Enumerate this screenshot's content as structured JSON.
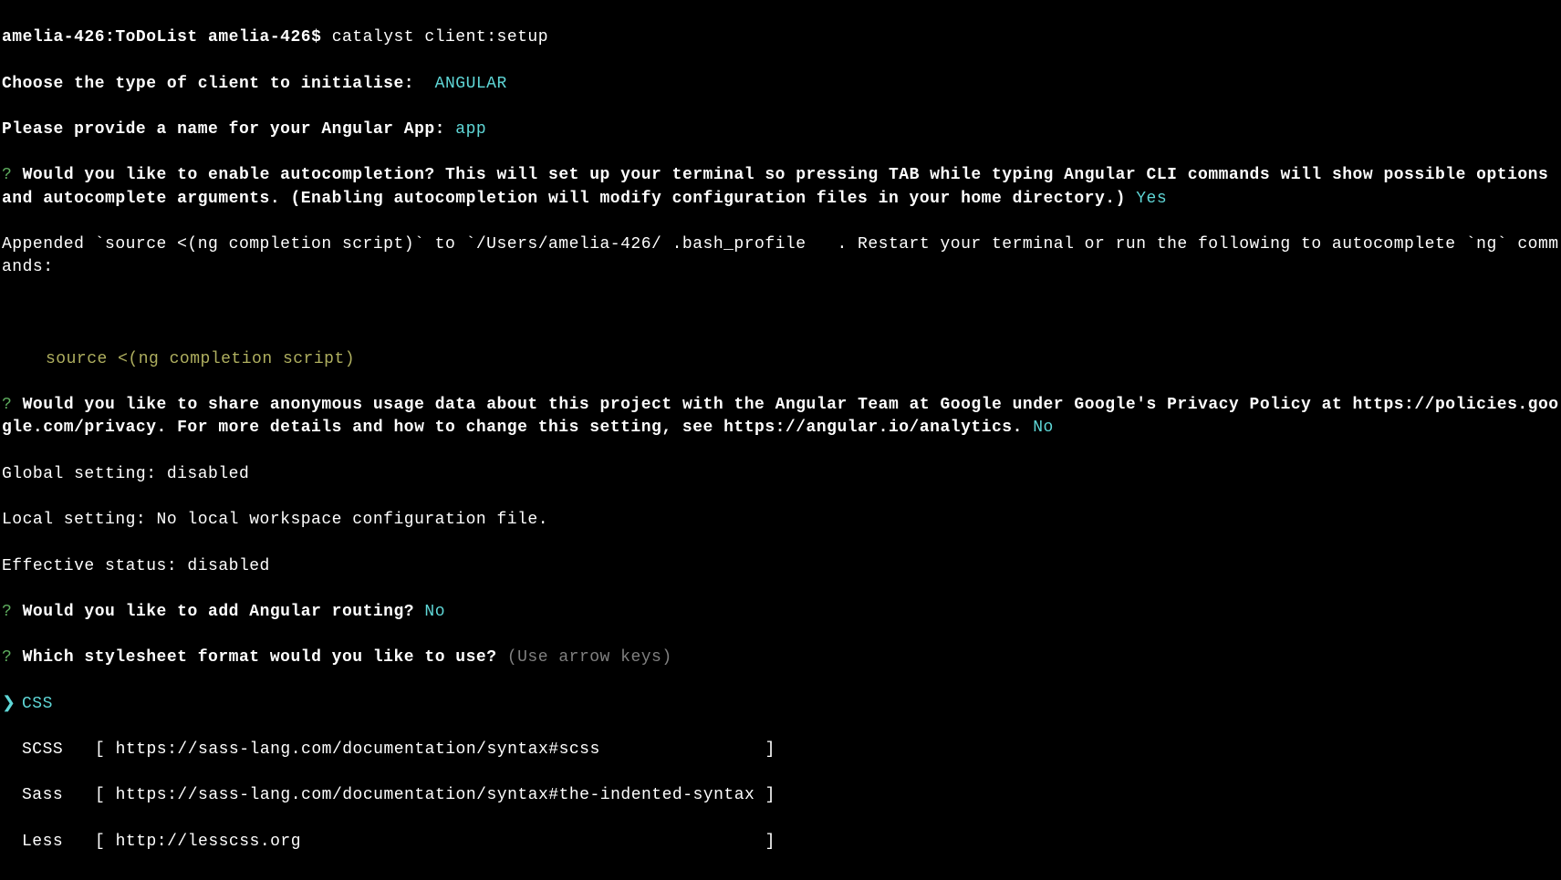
{
  "prompt": {
    "host": "amelia-426:ToDoList",
    "user": "amelia-426$",
    "command": "catalyst client:setup"
  },
  "q_client_type": {
    "label": "Choose the type of client to initialise: ",
    "answer": " ANGULAR"
  },
  "q_app_name": {
    "label": "Please provide a name for your Angular App:",
    "answer": "app"
  },
  "q_autocomplete": {
    "marker": "?",
    "text": "Would you like to enable autocompletion? This will set up your terminal so pressing TAB while typing Angular CLI commands will show possible options and autocomplete arguments. (Enabling autocompletion will modify configuration files in your home directory.)",
    "answer": "Yes"
  },
  "appended_msg": "Appended `source <(ng completion script)` to `/Users/amelia-426/ .bash_profile   . Restart your terminal or run the following to autocomplete `ng` commands:",
  "source_cmd": "source <(ng completion script)",
  "q_analytics": {
    "marker": "?",
    "text": "Would you like to share anonymous usage data about this project with the Angular Team at Google under Google's Privacy Policy at https://policies.google.com/privacy. For more details and how to change this setting, see https://angular.io/analytics.",
    "answer": "No"
  },
  "global_setting": "Global setting: disabled",
  "local_setting": "Local setting: No local workspace configuration file.",
  "effective_status": "Effective status: disabled",
  "q_routing": {
    "marker": "?",
    "text": "Would you like to add Angular routing?",
    "answer": "No"
  },
  "q_stylesheet": {
    "marker": "?",
    "text": "Which stylesheet format would you like to use?",
    "hint": "(Use arrow keys)"
  },
  "options": [
    {
      "marker": "❯",
      "name": "CSS",
      "url": "",
      "selected": true
    },
    {
      "marker": " ",
      "name": "SCSS",
      "url": "[ https://sass-lang.com/documentation/syntax#scss                ]",
      "selected": false
    },
    {
      "marker": " ",
      "name": "Sass",
      "url": "[ https://sass-lang.com/documentation/syntax#the-indented-syntax ]",
      "selected": false
    },
    {
      "marker": " ",
      "name": "Less",
      "url": "[ http://lesscss.org                                             ]",
      "selected": false
    }
  ]
}
